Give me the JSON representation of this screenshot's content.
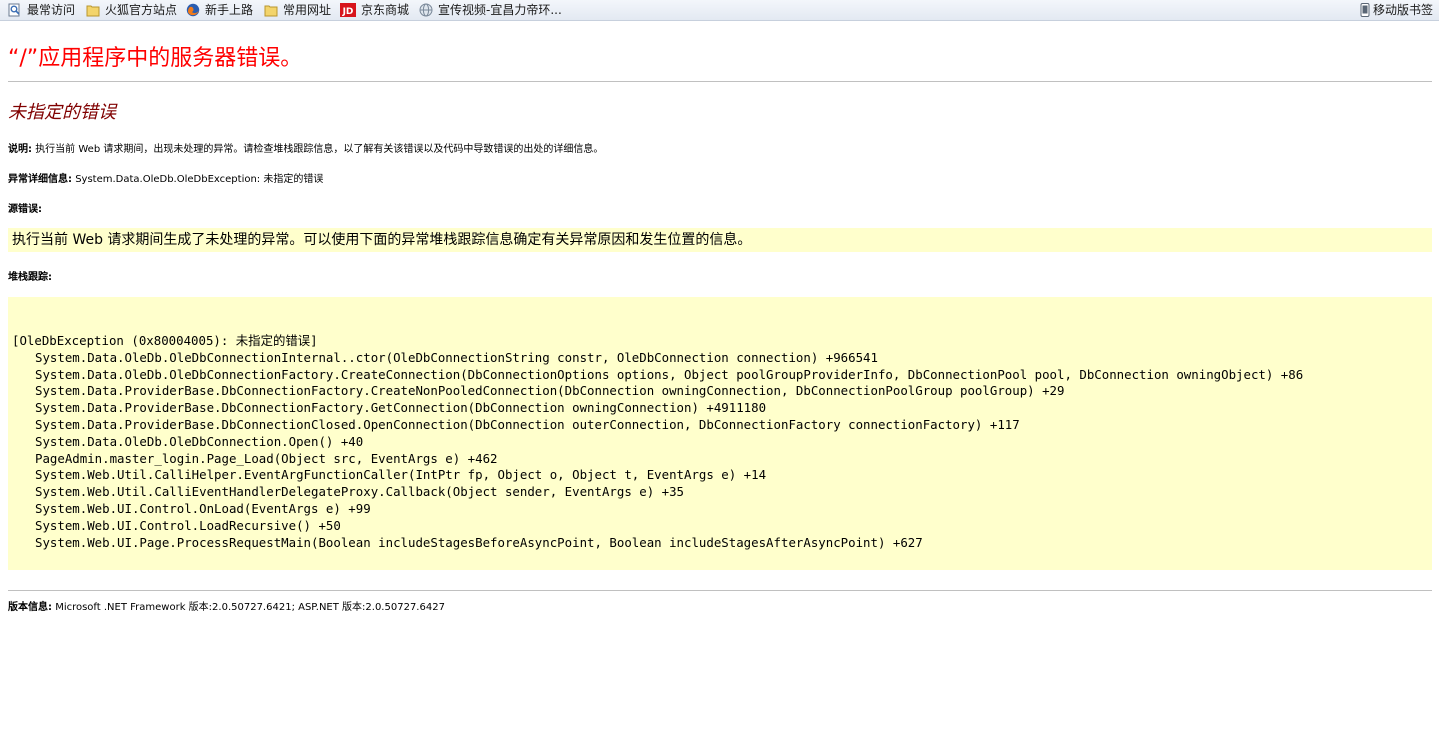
{
  "bookmarks": {
    "items": [
      {
        "label": "最常访问",
        "icon": "search-page-icon"
      },
      {
        "label": "火狐官方站点",
        "icon": "folder-icon"
      },
      {
        "label": "新手上路",
        "icon": "firefox-icon"
      },
      {
        "label": "常用网址",
        "icon": "folder-icon"
      },
      {
        "label": "京东商城",
        "icon": "jd-logo-icon"
      },
      {
        "label": "宣传视频-宜昌力帝环...",
        "icon": "globe-icon"
      }
    ],
    "mobile": {
      "label": "移动版书签",
      "icon": "mobile-phone-icon"
    }
  },
  "page": {
    "title": "“/”应用程序中的服务器错误。",
    "subtitle": "未指定的错误",
    "description_label": "说明:",
    "description_text": "执行当前 Web 请求期间，出现未处理的异常。请检查堆栈跟踪信息，以了解有关该错误以及代码中导致错误的出处的详细信息。",
    "exception_label": "异常详细信息:",
    "exception_text": "System.Data.OleDb.OleDbException: 未指定的错误",
    "source_error_label": "源错误:",
    "source_error_text": "执行当前 Web 请求期间生成了未处理的异常。可以使用下面的异常堆栈跟踪信息确定有关异常原因和发生位置的信息。",
    "stack_label": "堆栈跟踪:",
    "stack_header": "[OleDbException (0x80004005): 未指定的错误]",
    "stack_lines": [
      "System.Data.OleDb.OleDbConnectionInternal..ctor(OleDbConnectionString constr, OleDbConnection connection) +966541",
      "System.Data.OleDb.OleDbConnectionFactory.CreateConnection(DbConnectionOptions options, Object poolGroupProviderInfo, DbConnectionPool pool, DbConnection owningObject) +86",
      "System.Data.ProviderBase.DbConnectionFactory.CreateNonPooledConnection(DbConnection owningConnection, DbConnectionPoolGroup poolGroup) +29",
      "System.Data.ProviderBase.DbConnectionFactory.GetConnection(DbConnection owningConnection) +4911180",
      "System.Data.ProviderBase.DbConnectionClosed.OpenConnection(DbConnection outerConnection, DbConnectionFactory connectionFactory) +117",
      "System.Data.OleDb.OleDbConnection.Open() +40",
      "PageAdmin.master_login.Page_Load(Object src, EventArgs e) +462",
      "System.Web.Util.CalliHelper.EventArgFunctionCaller(IntPtr fp, Object o, Object t, EventArgs e) +14",
      "System.Web.Util.CalliEventHandlerDelegateProxy.Callback(Object sender, EventArgs e) +35",
      "System.Web.UI.Control.OnLoad(EventArgs e) +99",
      "System.Web.UI.Control.LoadRecursive() +50",
      "System.Web.UI.Page.ProcessRequestMain(Boolean includeStagesBeforeAsyncPoint, Boolean includeStagesAfterAsyncPoint) +627"
    ],
    "version_label": "版本信息:",
    "version_text": "Microsoft .NET Framework 版本:2.0.50727.6421; ASP.NET 版本:2.0.50727.6427"
  },
  "colors": {
    "title": "#ff0000",
    "subtitle": "#800000",
    "code_background": "#ffffcc"
  }
}
